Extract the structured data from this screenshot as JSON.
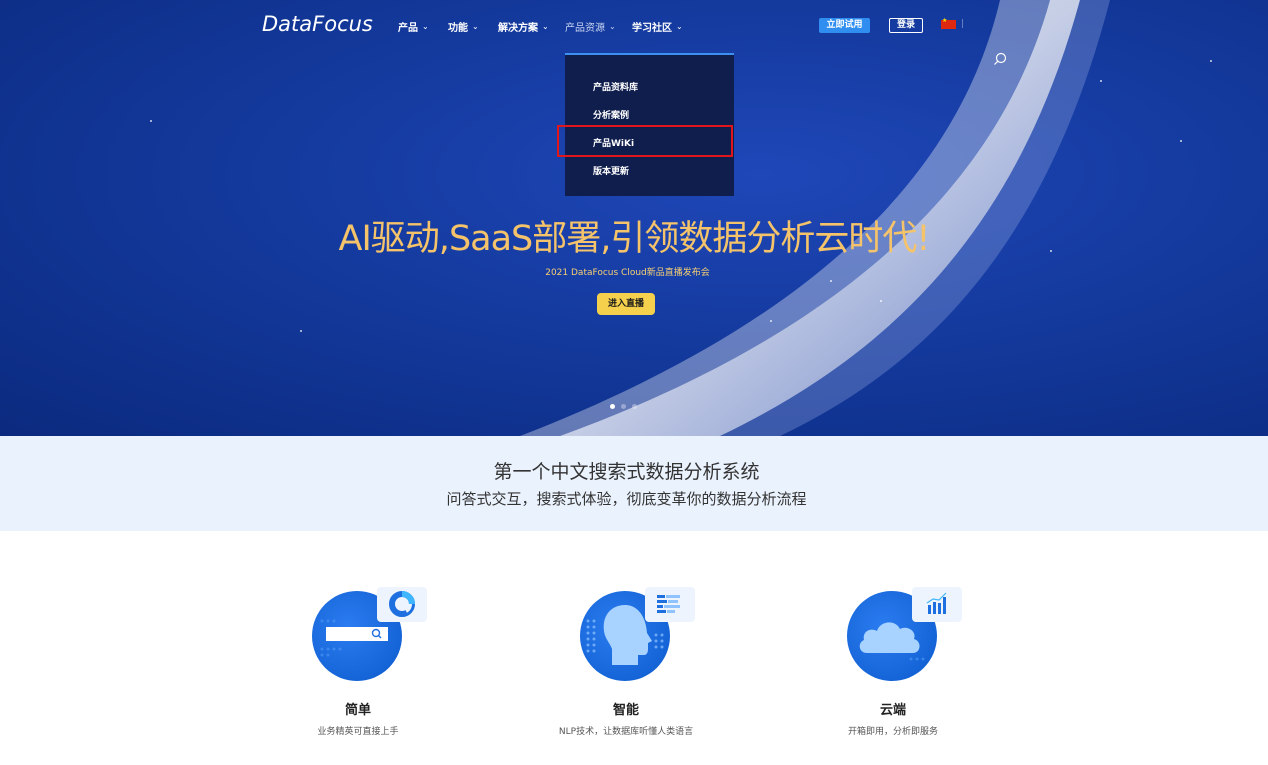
{
  "logo": "DataFocus",
  "nav": {
    "items": [
      {
        "label": "产品"
      },
      {
        "label": "功能"
      },
      {
        "label": "解决方案"
      },
      {
        "label": "产品资源"
      },
      {
        "label": "学习社区"
      }
    ],
    "trial_label": "立即试用",
    "login_label": "登录",
    "lang_sep": "|"
  },
  "dropdown": {
    "items": [
      "产品资料库",
      "分析案例",
      "产品WiKi",
      "版本更新"
    ]
  },
  "hero": {
    "headline": "AI驱动,SaaS部署,引领数据分析云时代!",
    "subline": "2021 DataFocus Cloud新品直播发布会",
    "button": "进入直播"
  },
  "band": {
    "title": "第一个中文搜索式数据分析系统",
    "subtitle": "问答式交互，搜索式体验，彻底变革你的数据分析流程"
  },
  "features": [
    {
      "title": "简单",
      "desc": "业务精英可直接上手"
    },
    {
      "title": "智能",
      "desc": "NLP技术，让数据库听懂人类语言"
    },
    {
      "title": "云端",
      "desc": "开箱即用，分析即服务"
    }
  ],
  "colors": {
    "hero_bg": "#143a9e",
    "accent": "#2f8ef0",
    "headline": "#f4c36a",
    "live_button": "#f5d04c",
    "highlight_box": "#e0161b",
    "band_bg": "#eaf2fd"
  }
}
